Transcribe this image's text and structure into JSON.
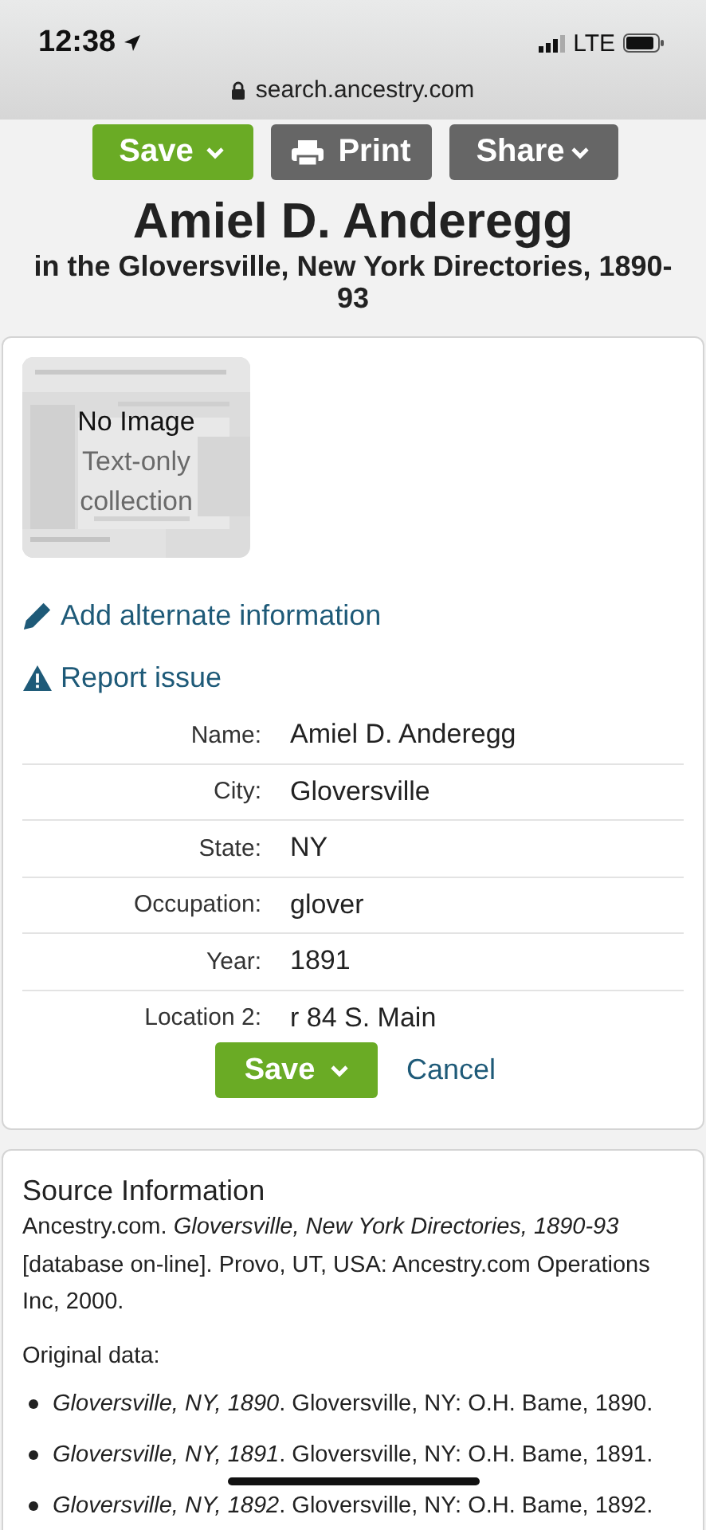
{
  "status_bar": {
    "time": "12:38",
    "network": "LTE"
  },
  "browser": {
    "url": "search.ancestry.com"
  },
  "actions": [
    {
      "kind": "save",
      "label": "Save"
    },
    {
      "kind": "print",
      "label": "Print"
    },
    {
      "kind": "share",
      "label": "Share"
    }
  ],
  "title": "Amiel D. Anderegg",
  "subtitle": "in the Gloversville, New York Directories, 1890-93",
  "thumbnail": {
    "title": "No Image",
    "caption": "Text-only collection"
  },
  "links": [
    {
      "kind": "edit",
      "label": "Add alternate information"
    },
    {
      "kind": "warning",
      "label": "Report issue"
    }
  ],
  "fields": [
    {
      "label": "Name:",
      "value": "Amiel D. Anderegg"
    },
    {
      "label": "City:",
      "value": "Gloversville"
    },
    {
      "label": "State:",
      "value": "NY"
    },
    {
      "label": "Occupation:",
      "value": "glover"
    },
    {
      "label": "Year:",
      "value": "1891"
    },
    {
      "label": "Location 2:",
      "value": "r 84 S. Main"
    }
  ],
  "form_buttons": {
    "save": "Save",
    "cancel": "Cancel"
  },
  "source": {
    "heading": "Source Information",
    "citation": "Ancestry.com. *Gloversville, New York Directories, 1890-93* [database on-line]. Provo, UT, USA: Ancestry.com Operations Inc, 2000.",
    "original_label": "Original data:",
    "items": [
      "*Gloversville, NY, 1890*. Gloversville, NY: O.H. Bame, 1890.",
      "*Gloversville, NY, 1891*. Gloversville, NY: O.H. Bame, 1891.",
      "*Gloversville, NY, 1892*. Gloversville, NY: O.H. Bame, 1892."
    ]
  }
}
